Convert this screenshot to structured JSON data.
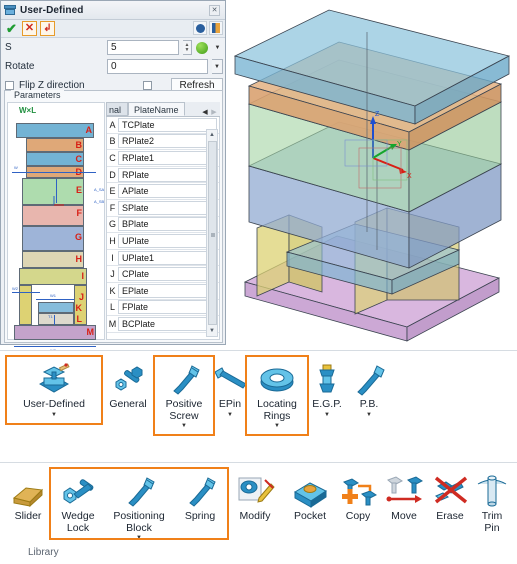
{
  "dialog": {
    "title": "User-Defined",
    "close_label": "✕",
    "commands": {
      "ok": "✔",
      "cancel": "✕",
      "reset": "↲"
    },
    "fields": [
      {
        "label": "S",
        "value": "5",
        "has_spinner": true,
        "has_globe": true,
        "has_caret": true
      },
      {
        "label": "Rotate",
        "value": "0",
        "has_spinner": false,
        "has_globe": false,
        "has_caret": true
      }
    ],
    "flip_z": {
      "label": "Flip Z direction",
      "checked": false
    },
    "refresh_button": "Refresh",
    "parameters_legend": "Parameters",
    "diagram": {
      "wl_label": "W×L",
      "dim_w": "W",
      "dim_w1": "W1",
      "dim_w2": "W2",
      "dim_w3": "W3",
      "dim_a": "A_SA",
      "dim_b": "A_SB",
      "dim_t": "T1"
    },
    "tabs": [
      {
        "label": "nal",
        "active": false
      },
      {
        "label": "PlateName",
        "active": true
      }
    ],
    "tab_nav": {
      "prev": "◀",
      "next": "▶"
    },
    "table": {
      "rows": [
        {
          "key": "A",
          "value": "TCPlate"
        },
        {
          "key": "B",
          "value": "RPlate2"
        },
        {
          "key": "C",
          "value": "RPlate1"
        },
        {
          "key": "D",
          "value": "RPlate"
        },
        {
          "key": "E",
          "value": "APlate"
        },
        {
          "key": "F",
          "value": "SPlate"
        },
        {
          "key": "G",
          "value": "BPlate"
        },
        {
          "key": "H",
          "value": "UPlate"
        },
        {
          "key": "I",
          "value": "UPlate1"
        },
        {
          "key": "J",
          "value": "CPlate"
        },
        {
          "key": "K",
          "value": "EPlate"
        },
        {
          "key": "L",
          "value": "FPlate"
        },
        {
          "key": "M",
          "value": "BCPlate"
        }
      ]
    },
    "scrollbar": {
      "up": "▲",
      "down": "▼"
    }
  },
  "layers": [
    {
      "id": "A",
      "color": "#73b3d4"
    },
    {
      "id": "B",
      "color": "#dfa878"
    },
    {
      "id": "C",
      "color": "#73b3d4"
    },
    {
      "id": "D",
      "color": "#dfa878"
    },
    {
      "id": "E",
      "color": "#aedcae"
    },
    {
      "id": "F",
      "color": "#e8b6ae"
    },
    {
      "id": "G",
      "color": "#9eb4d8"
    },
    {
      "id": "H",
      "color": "#ded6b4"
    },
    {
      "id": "I",
      "color": "#d4d78c"
    },
    {
      "id": "J",
      "color": "#ddd273"
    },
    {
      "id": "K",
      "color": "#86bcdb"
    },
    {
      "id": "L",
      "color": "#ddd9cd"
    },
    {
      "id": "M",
      "color": "#c4a3cb"
    }
  ],
  "ribbon1": {
    "items": [
      {
        "name": "user-defined",
        "label": "User-Defined",
        "caret": true,
        "highlight": true,
        "icon": "vise-icon"
      },
      {
        "name": "general",
        "label": "General",
        "caret": false,
        "highlight": false,
        "icon": "bolt-nut-icon"
      },
      {
        "name": "positive-screw",
        "label": "Positive Screw",
        "caret": true,
        "highlight": true,
        "icon": "screw-icon"
      },
      {
        "name": "epin",
        "label": "EPin",
        "caret": true,
        "highlight": false,
        "icon": "ejector-pin-icon"
      },
      {
        "name": "locating-rings",
        "label": "Locating Rings",
        "caret": true,
        "highlight": true,
        "icon": "ring-icon"
      },
      {
        "name": "egp",
        "label": "E.G.P.",
        "caret": true,
        "highlight": false,
        "icon": "guide-pillar-icon"
      },
      {
        "name": "pb",
        "label": "P.B.",
        "caret": true,
        "highlight": false,
        "icon": "push-bar-icon"
      }
    ]
  },
  "ribbon2": {
    "group_label": "Library",
    "items": [
      {
        "name": "slider",
        "label": "Slider",
        "caret": false,
        "highlight": false,
        "icon": "slider-icon"
      },
      {
        "name": "wedge-lock",
        "label": "Wedge Lock",
        "caret": false,
        "highlight": true,
        "icon": "wedge-lock-icon"
      },
      {
        "name": "positioning-block",
        "label": "Positioning Block",
        "caret": true,
        "highlight": true,
        "icon": "positioning-block-icon"
      },
      {
        "name": "spring",
        "label": "Spring",
        "caret": false,
        "highlight": true,
        "icon": "spring-icon"
      },
      {
        "name": "modify",
        "label": "Modify",
        "caret": false,
        "highlight": false,
        "icon": "modify-icon"
      },
      {
        "name": "pocket",
        "label": "Pocket",
        "caret": false,
        "highlight": false,
        "icon": "pocket-icon"
      },
      {
        "name": "copy",
        "label": "Copy",
        "caret": false,
        "highlight": false,
        "icon": "copy-icon"
      },
      {
        "name": "move",
        "label": "Move",
        "caret": false,
        "highlight": false,
        "icon": "move-icon"
      },
      {
        "name": "erase",
        "label": "Erase",
        "caret": false,
        "highlight": false,
        "icon": "erase-icon"
      },
      {
        "name": "trim-pin",
        "label": "Trim Pin",
        "caret": false,
        "highlight": false,
        "icon": "trim-pin-icon"
      }
    ]
  },
  "colors": {
    "highlight": "#f08019",
    "accent_blue": "#2a7fb8",
    "label_red": "#d81f15",
    "dim_blue": "#2f62c4"
  }
}
